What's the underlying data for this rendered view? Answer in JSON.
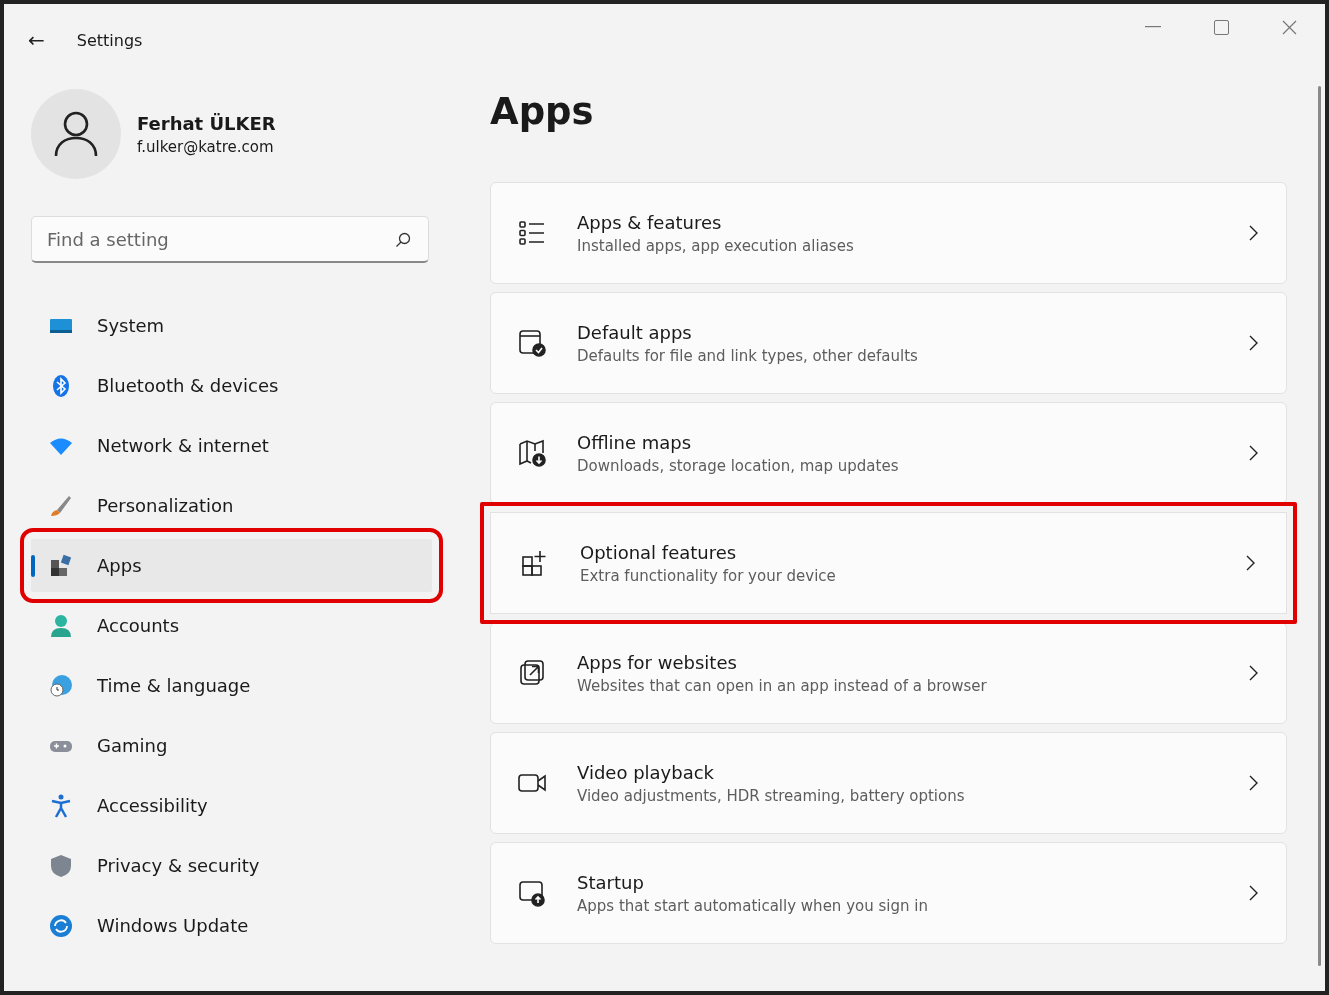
{
  "window": {
    "title": "Settings",
    "back_glyph": "←"
  },
  "user": {
    "name": "Ferhat ÜLKER",
    "email": "f.ulker@katre.com"
  },
  "search": {
    "placeholder": "Find a setting"
  },
  "nav": [
    {
      "label": "System",
      "selected": false,
      "highlighted": false
    },
    {
      "label": "Bluetooth & devices",
      "selected": false,
      "highlighted": false
    },
    {
      "label": "Network & internet",
      "selected": false,
      "highlighted": false
    },
    {
      "label": "Personalization",
      "selected": false,
      "highlighted": false
    },
    {
      "label": "Apps",
      "selected": true,
      "highlighted": true
    },
    {
      "label": "Accounts",
      "selected": false,
      "highlighted": false
    },
    {
      "label": "Time & language",
      "selected": false,
      "highlighted": false
    },
    {
      "label": "Gaming",
      "selected": false,
      "highlighted": false
    },
    {
      "label": "Accessibility",
      "selected": false,
      "highlighted": false
    },
    {
      "label": "Privacy & security",
      "selected": false,
      "highlighted": false
    },
    {
      "label": "Windows Update",
      "selected": false,
      "highlighted": false
    }
  ],
  "page_title": "Apps",
  "cards": [
    {
      "title": "Apps & features",
      "subtitle": "Installed apps, app execution aliases",
      "highlighted": false
    },
    {
      "title": "Default apps",
      "subtitle": "Defaults for file and link types, other defaults",
      "highlighted": false
    },
    {
      "title": "Offline maps",
      "subtitle": "Downloads, storage location, map updates",
      "highlighted": false
    },
    {
      "title": "Optional features",
      "subtitle": "Extra functionality for your device",
      "highlighted": true
    },
    {
      "title": "Apps for websites",
      "subtitle": "Websites that can open in an app instead of a browser",
      "highlighted": false
    },
    {
      "title": "Video playback",
      "subtitle": "Video adjustments, HDR streaming, battery options",
      "highlighted": false
    },
    {
      "title": "Startup",
      "subtitle": "Apps that start automatically when you sign in",
      "highlighted": false
    }
  ]
}
